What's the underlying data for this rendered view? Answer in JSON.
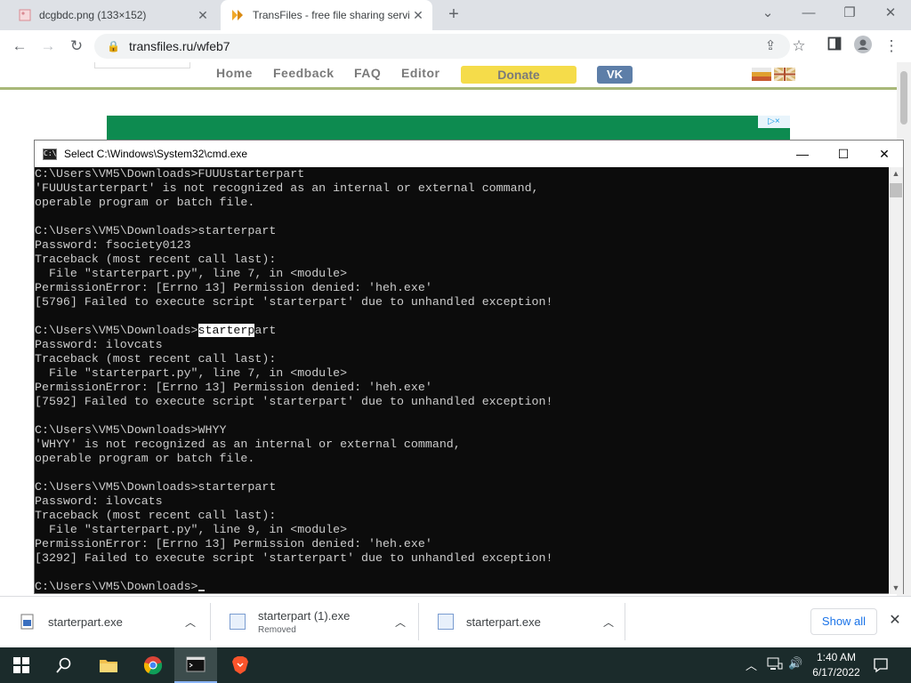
{
  "browser": {
    "tabs": [
      {
        "title": "dcgbdc.png (133×152)",
        "active": false
      },
      {
        "title": "TransFiles - free file sharing servi",
        "active": true
      }
    ],
    "url": "transfiles.ru/wfeb7"
  },
  "website": {
    "nav": [
      "Home",
      "Feedback",
      "FAQ",
      "Editor"
    ],
    "donate": "Donate",
    "vk": "VK",
    "adchoice_label": "▷×"
  },
  "cmd": {
    "title": "Select C:\\Windows\\System32\\cmd.exe",
    "lines": [
      "C:\\Users\\VM5\\Downloads>FUUUstarterpart",
      "'FUUUstarterpart' is not recognized as an internal or external command,",
      "operable program or batch file.",
      "",
      "C:\\Users\\VM5\\Downloads>starterpart",
      "Password: fsociety0123",
      "Traceback (most recent call last):",
      "  File \"starterpart.py\", line 7, in <module>",
      "PermissionError: [Errno 13] Permission denied: 'heh.exe'",
      "[5796] Failed to execute script 'starterpart' due to unhandled exception!",
      "",
      "C:\\Users\\VM5\\Downloads>starterpart",
      "Password: ilovcats",
      "Traceback (most recent call last):",
      "  File \"starterpart.py\", line 7, in <module>",
      "PermissionError: [Errno 13] Permission denied: 'heh.exe'",
      "[7592] Failed to execute script 'starterpart' due to unhandled exception!",
      "",
      "C:\\Users\\VM5\\Downloads>WHYY",
      "'WHYY' is not recognized as an internal or external command,",
      "operable program or batch file.",
      "",
      "C:\\Users\\VM5\\Downloads>starterpart",
      "Password: ilovcats",
      "Traceback (most recent call last):",
      "  File \"starterpart.py\", line 9, in <module>",
      "PermissionError: [Errno 13] Permission denied: 'heh.exe'",
      "[3292] Failed to execute script 'starterpart' due to unhandled exception!",
      "",
      "C:\\Users\\VM5\\Downloads>"
    ],
    "selection": {
      "line": 11,
      "prefix": "C:\\Users\\VM5\\Downloads>",
      "selected": "starterp",
      "suffix": "art"
    }
  },
  "downloads": {
    "items": [
      {
        "name": "starterpart.exe",
        "status": ""
      },
      {
        "name": "starterpart (1).exe",
        "status": "Removed"
      },
      {
        "name": "starterpart.exe",
        "status": ""
      }
    ],
    "show_all": "Show all"
  },
  "taskbar": {
    "time": "1:40 AM",
    "date": "6/17/2022"
  }
}
